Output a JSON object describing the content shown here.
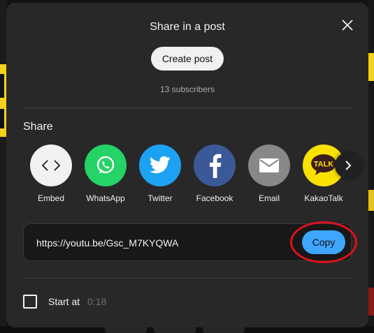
{
  "dialog": {
    "title": "Share in a post",
    "create_post_label": "Create post",
    "subscribers": "13 subscribers",
    "share_heading": "Share",
    "apps": [
      {
        "label": "Embed",
        "icon": "embed-icon",
        "color": "#f1f1f1"
      },
      {
        "label": "WhatsApp",
        "icon": "whatsapp-icon",
        "color": "#25d366"
      },
      {
        "label": "Twitter",
        "icon": "twitter-icon",
        "color": "#1da1f2"
      },
      {
        "label": "Facebook",
        "icon": "facebook-icon",
        "color": "#3b5998"
      },
      {
        "label": "Email",
        "icon": "email-icon",
        "color": "#888888"
      },
      {
        "label": "KakaoTalk",
        "icon": "kakaotalk-icon",
        "color": "#fae100"
      }
    ],
    "kakao_badge": "TALK",
    "url": "https://youtu.be/Gsc_M7KYQWA",
    "copy_label": "Copy",
    "start_at_label": "Start at",
    "start_at_time": "0:18"
  },
  "colors": {
    "dialog_bg": "#282828",
    "accent": "#3ea6ff",
    "highlight_ring": "#e0101b"
  }
}
